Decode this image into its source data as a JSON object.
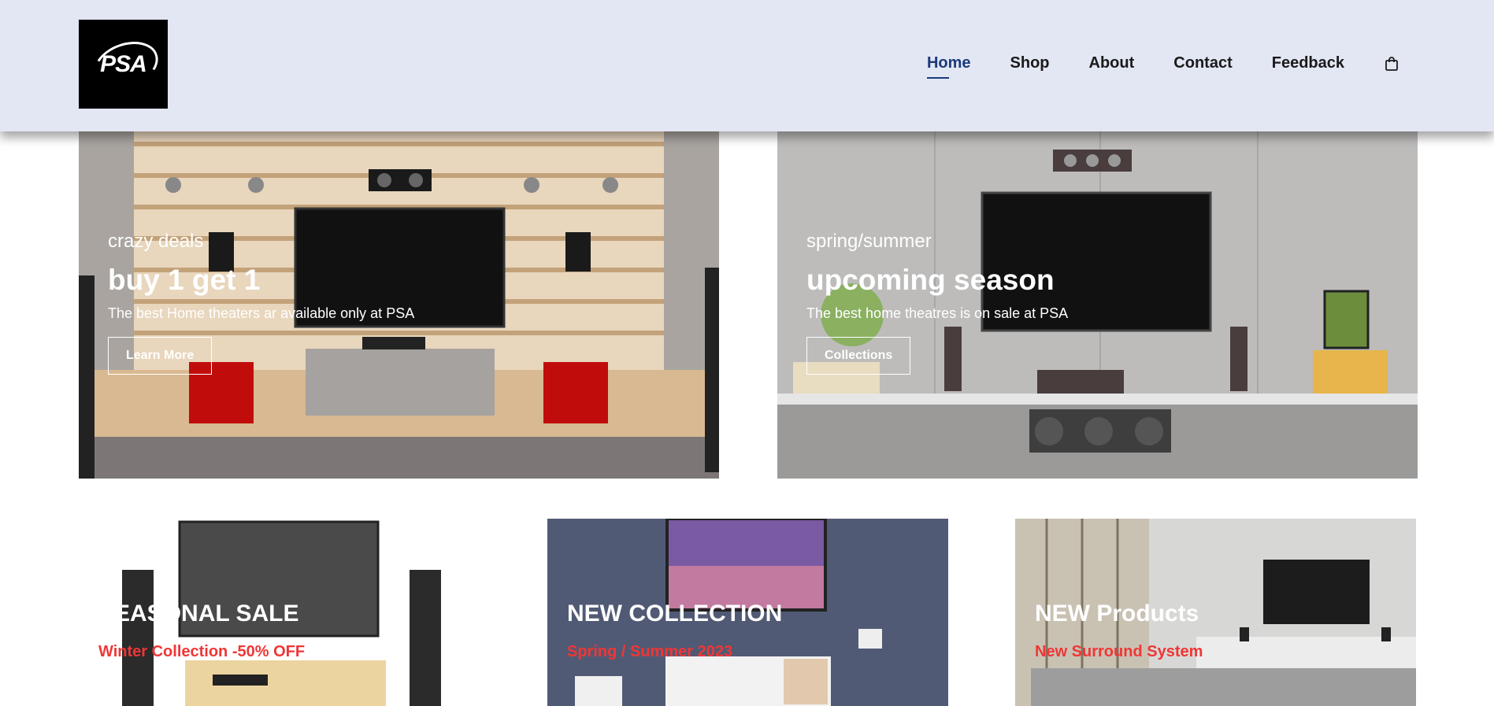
{
  "header": {
    "logo_text": "PSA",
    "nav": [
      {
        "label": "Home",
        "active": true
      },
      {
        "label": "Shop"
      },
      {
        "label": "About"
      },
      {
        "label": "Contact"
      },
      {
        "label": "Feedback"
      }
    ],
    "cart_icon": "shopping-bag-icon",
    "accent_color": "#1b3a7a"
  },
  "banners": [
    {
      "kicker": "crazy deals",
      "title": "buy 1 get 1",
      "description": "The best Home theaters ar available only at PSA",
      "button": "Learn More"
    },
    {
      "kicker": "spring/summer",
      "title": "upcoming season",
      "description": "The best home theatres is on sale at PSA",
      "button": "Collections"
    }
  ],
  "cards": [
    {
      "title": "SEASONAL SALE",
      "subtitle": "Winter Collection -50% OFF"
    },
    {
      "title": "NEW COLLECTION",
      "subtitle": "Spring / Summer 2023"
    },
    {
      "title": "NEW Products",
      "subtitle": "New Surround System"
    }
  ],
  "colors": {
    "header_bg": "#e3e6f3",
    "card_subtitle": "#ef3636"
  }
}
